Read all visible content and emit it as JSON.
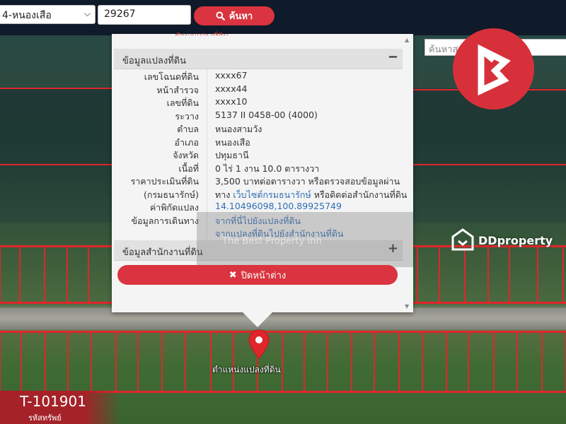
{
  "search": {
    "district_value": "4-หนองเสือ",
    "parcel_value": "29267",
    "button_label": "ค้นหา",
    "place_search_placeholder": "ค้นหาสถานที่..."
  },
  "popup": {
    "top_clip_text": "ข้อมูลแปลงที่ดิน",
    "land_panel_title": "ข้อมูลแปลงที่ดิน",
    "land_panel_toggle": "−",
    "office_panel_title": "ข้อมูลสำนักงานที่ดิน",
    "office_panel_toggle": "+",
    "rows": [
      {
        "label": "เลขโฉนดที่ดิน",
        "value": "xxxx67"
      },
      {
        "label": "หน้าสำรวจ",
        "value": "xxxx44"
      },
      {
        "label": "เลขที่ดิน",
        "value": "xxxx10"
      },
      {
        "label": "ระวาง",
        "value": "5137 II 0458-00 (4000)"
      },
      {
        "label": "ตำบล",
        "value": "หนองสามวัง"
      },
      {
        "label": "อำเภอ",
        "value": "หนองเสือ"
      },
      {
        "label": "จังหวัด",
        "value": "ปทุมธานี"
      },
      {
        "label": "เนื้อที่",
        "value": "0 ไร่ 1 งาน 10.0 ตารางวา"
      }
    ],
    "price": {
      "label_1": "ราคาประเมินที่ดิน",
      "label_2": "(กรมธนารักษ์)",
      "value_1": "3,500 บาทต่อตารางวา หรือตรวจสอบข้อมูลผ่าน",
      "value_2_prefix": "ทาง",
      "value_2_link": "เว็บไซต์กรมธนารักษ์",
      "value_2_suffix": "หรือติดต่อสำนักงานที่ดิน"
    },
    "coords": {
      "label": "ค่าพิกัดแปลง",
      "value": "14.10496098,100.89925749"
    },
    "directions": {
      "label": "ข้อมูลการเดินทาง",
      "link_1": "จากที่นี่ไปยังแปลงที่ดิน",
      "link_2": "จากแปลงที่ดินไปยังสำนักงานที่ดิน"
    },
    "close_label": "ปิดหน้าต่าง",
    "close_icon": "✖"
  },
  "watermark": "The Best Property Inn",
  "marker_label": "ตำแหน่งแปลงที่ดิน",
  "logos": {
    "dd_text": "DDproperty"
  },
  "badge": {
    "code": "T-101901",
    "sub": "รหัสทรัพย์"
  },
  "colors": {
    "accent_red": "#d9343f",
    "link_blue": "#2f6fb8",
    "plot_line": "#e0262b"
  }
}
